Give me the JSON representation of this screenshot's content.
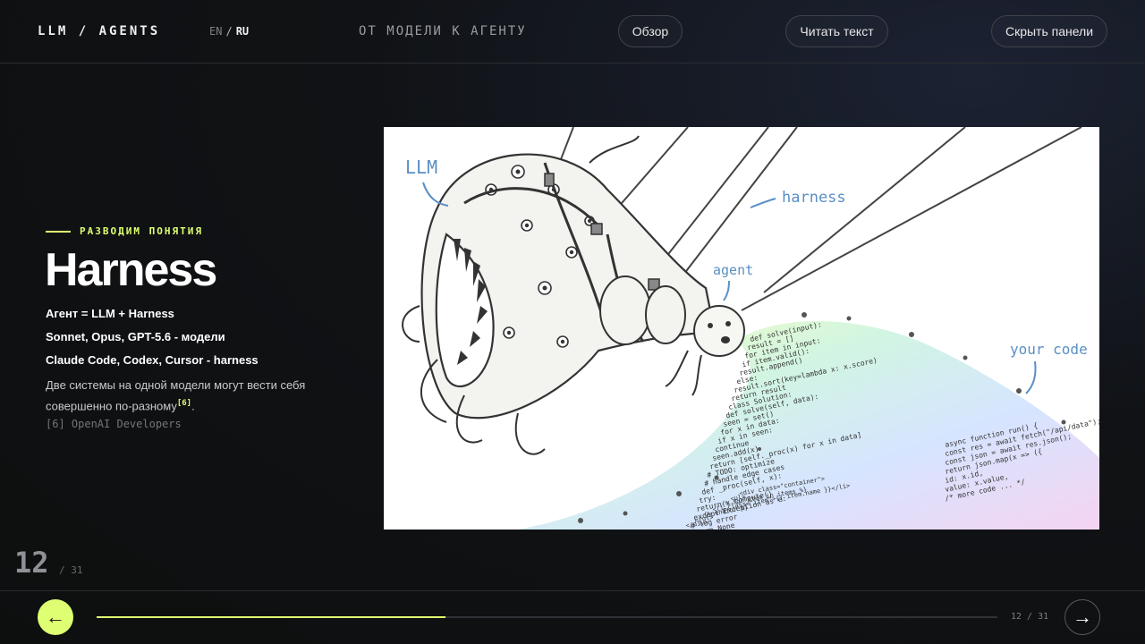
{
  "header": {
    "brand": "LLM / AGENTS",
    "lang_en": "EN",
    "lang_sep": "/",
    "lang_ru": "RU",
    "section_title": "ОТ МОДЕЛИ К АГЕНТУ",
    "overview_label": "Обзор",
    "read_label": "Читать текст",
    "hide_label": "Скрыть панели"
  },
  "slide": {
    "eyebrow": "РАЗВОДИМ ПОНЯТИЯ",
    "title": "Harness",
    "bullets": [
      "Агент = LLM + Harness",
      "Sonnet, Opus, GPT-5.6 - модели",
      "Claude Code, Codex, Cursor - harness"
    ],
    "description": "Две системы на одной модели могут вести себя совершенно по-разному",
    "footnote_mark": "[6]",
    "description_end": ".",
    "reference": "[6]  OpenAI Developers"
  },
  "illustration": {
    "label_llm": "LLM",
    "label_harness": "harness",
    "label_agent": "agent",
    "label_code": "your code",
    "code_lines": [
      "def solve(input):",
      "result = []",
      "for item in input:",
      "if item.valid():",
      "result.append()",
      "else:",
      "result.sort(key=lambda x: x.score)",
      "return result",
      "class Solution:",
      "def solve(self, data):",
      "seen = set()",
      "for x in data:",
      "if x in seen:",
      "continue",
      "seen.add(x)",
      "return [self._proc(x) for x in data]",
      "# TODO: optimize",
      "# handle edge cases",
      "def _proc(self, x):",
      "try:",
      "return x.compute()",
      "except Exception as e:",
      "# log error",
      "return None"
    ],
    "js_lines": [
      "async function run() {",
      "const res = await fetch(\"/api/data\");",
      "const json = await res.json();",
      "return json.map(x => ({",
      "id: x.id,",
      "value: x.value,",
      "/* more code ... */"
    ],
    "html_lines": [
      "<div class=\"container\">",
      "<ul>",
      "{% for item in items %}",
      "<li class=\"item\">{{ item.name }}</li>",
      "{% endfor %}",
      "</ul>",
      "</div>"
    ]
  },
  "pagination": {
    "current": "12",
    "total": "/ 31",
    "label": "12 / 31",
    "progress": 0.387
  },
  "nav": {
    "prev_icon": "←",
    "next_icon": "→"
  },
  "colors": {
    "accent": "#dfff72"
  }
}
